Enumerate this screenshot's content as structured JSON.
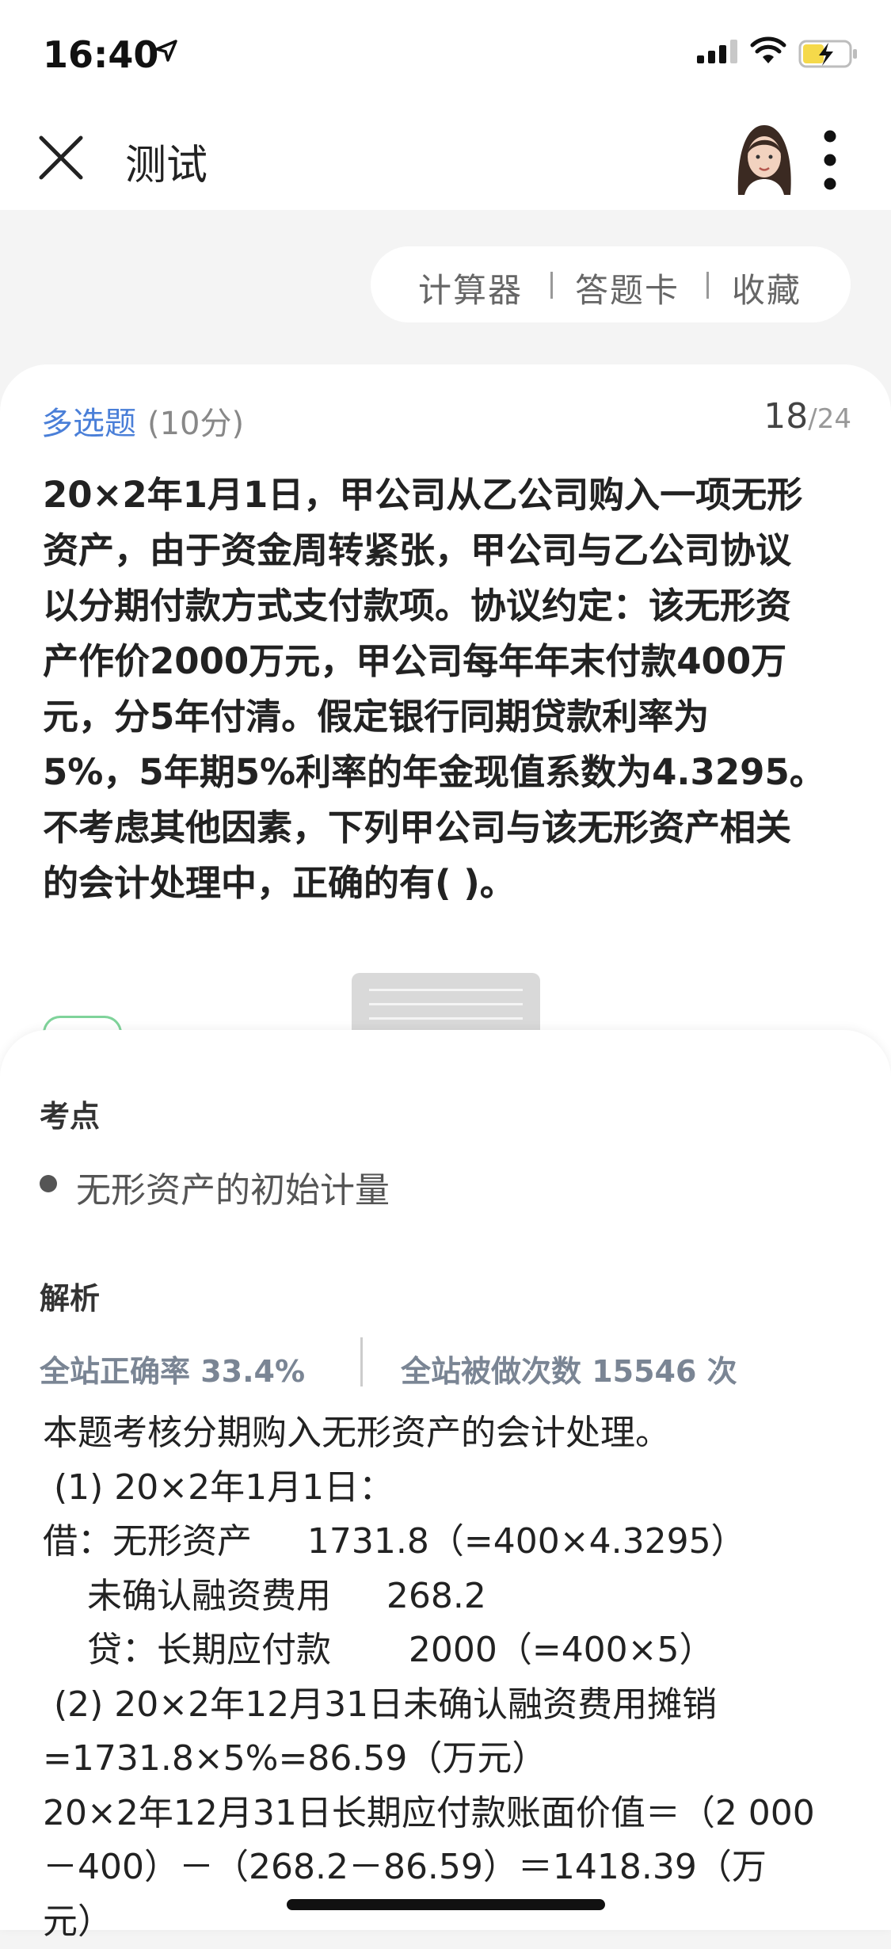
{
  "status_bar": {
    "time": "16:40"
  },
  "nav": {
    "title": "测试"
  },
  "tools": [
    "计算器",
    "答题卡",
    "收藏"
  ],
  "question": {
    "type": "多选题",
    "score": "(10分)",
    "index": "18",
    "total": "/24",
    "lines": [
      "20×2年1月1日，甲公司从乙公司购入一项无形",
      "资产，由于资金周转紧张，甲公司与乙公司协议",
      "以分期付款方式支付款项。协议约定：该无形资",
      "产作价2000万元，甲公司每年年末付款400万",
      "元，分5年付清。假定银行同期贷款利率为",
      "5%，5年期5%利率的年金现值系数为4.3295。",
      "不考虑其他因素，下列甲公司与该无形资产相关",
      "的会计处理中，正确的有(    )。"
    ]
  },
  "knowledge": {
    "title": "考点",
    "topic": "无形资产的初始计量"
  },
  "analysis": {
    "title": "解析",
    "accuracy": "全站正确率 33.4%",
    "attempts": "全站被做次数 15546 次",
    "lines": [
      "本题考核分期购入无形资产的会计处理。",
      " (1) 20×2年1月1日：",
      "借：无形资产     1731.8（=400×4.3295）",
      "    未确认融资费用     268.2",
      "    贷：长期应付款       2000（=400×5）",
      " (2) 20×2年12月31日未确认融资费用摊销",
      "=1731.8×5%=86.59（万元）",
      "20×2年12月31日长期应付款账面价值＝（2 000",
      "－400）－（268.2－86.59）＝1418.39（万",
      "元）"
    ]
  }
}
